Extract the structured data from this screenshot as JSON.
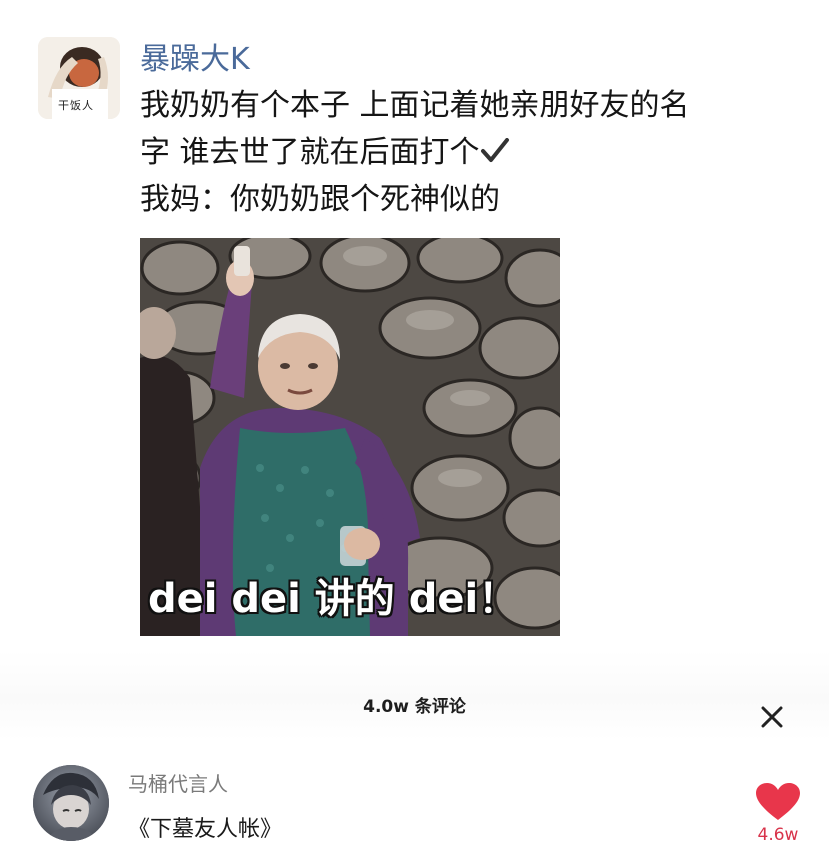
{
  "post": {
    "username": "暴躁大K",
    "avatar_caption": "干饭人",
    "text_line_1": "我奶奶有个本子 上面记着她亲朋好友的名",
    "text_line_2": "字 谁去世了就在后面打个",
    "text_line_2_icon": "checkmark-icon",
    "text_line_3": "我妈：你奶奶跟个死神似的"
  },
  "meme": {
    "caption": "dei dei 讲的 dei！"
  },
  "comments_sheet": {
    "count_label": "4.0w 条评论",
    "close_icon": "close-icon"
  },
  "comment": {
    "author": "马桶代言人",
    "text": "《下墓友人帐》",
    "like_count": "4.6w",
    "like_icon": "heart-icon",
    "like_color": "#e8364b"
  }
}
